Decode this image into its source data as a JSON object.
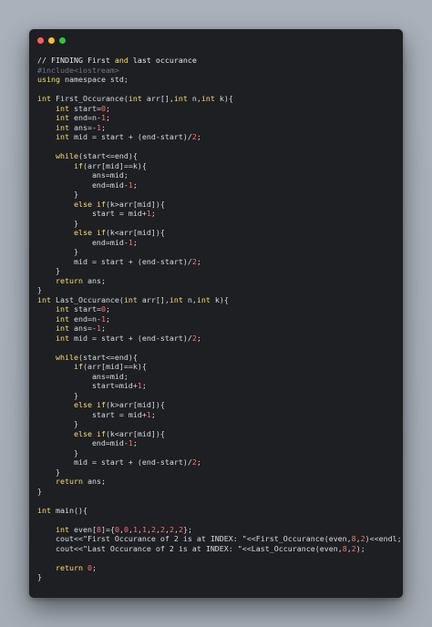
{
  "window": {
    "controls": [
      "close",
      "minimize",
      "maximize"
    ]
  },
  "code_lines": [
    [
      [
        "com",
        "// FINDING First "
      ],
      [
        "kw",
        "and"
      ],
      [
        "com",
        " last occurance"
      ]
    ],
    [
      [
        "pp",
        "#include<iostream>"
      ]
    ],
    [
      [
        "kw",
        "using"
      ],
      [
        "plain",
        " namespace std;"
      ]
    ],
    [],
    [
      [
        "ty",
        "int"
      ],
      [
        "plain",
        " First_Occurance("
      ],
      [
        "ty",
        "int"
      ],
      [
        "plain",
        " arr[],"
      ],
      [
        "ty",
        "int"
      ],
      [
        "plain",
        " n,"
      ],
      [
        "ty",
        "int"
      ],
      [
        "plain",
        " k){"
      ]
    ],
    [
      [
        "plain",
        "    "
      ],
      [
        "ty",
        "int"
      ],
      [
        "plain",
        " start="
      ],
      [
        "num",
        "0"
      ],
      [
        "plain",
        ";"
      ]
    ],
    [
      [
        "plain",
        "    "
      ],
      [
        "ty",
        "int"
      ],
      [
        "plain",
        " end=n-"
      ],
      [
        "num",
        "1"
      ],
      [
        "plain",
        ";"
      ]
    ],
    [
      [
        "plain",
        "    "
      ],
      [
        "ty",
        "int"
      ],
      [
        "plain",
        " ans=-"
      ],
      [
        "num",
        "1"
      ],
      [
        "plain",
        ";"
      ]
    ],
    [
      [
        "plain",
        "    "
      ],
      [
        "ty",
        "int"
      ],
      [
        "plain",
        " mid = start + (end-start)/"
      ],
      [
        "num",
        "2"
      ],
      [
        "plain",
        ";"
      ]
    ],
    [],
    [
      [
        "plain",
        "    "
      ],
      [
        "kw",
        "while"
      ],
      [
        "plain",
        "(start<=end){"
      ]
    ],
    [
      [
        "plain",
        "        "
      ],
      [
        "kw",
        "if"
      ],
      [
        "plain",
        "(arr[mid]==k){"
      ]
    ],
    [
      [
        "plain",
        "            ans=mid;"
      ]
    ],
    [
      [
        "plain",
        "            end=mid-"
      ],
      [
        "num",
        "1"
      ],
      [
        "plain",
        ";"
      ]
    ],
    [
      [
        "plain",
        "        }"
      ]
    ],
    [
      [
        "plain",
        "        "
      ],
      [
        "kw",
        "else if"
      ],
      [
        "plain",
        "(k>arr[mid]){"
      ]
    ],
    [
      [
        "plain",
        "            start = mid+"
      ],
      [
        "num",
        "1"
      ],
      [
        "plain",
        ";"
      ]
    ],
    [
      [
        "plain",
        "        }"
      ]
    ],
    [
      [
        "plain",
        "        "
      ],
      [
        "kw",
        "else if"
      ],
      [
        "plain",
        "(k<arr[mid]){"
      ]
    ],
    [
      [
        "plain",
        "            end=mid-"
      ],
      [
        "num",
        "1"
      ],
      [
        "plain",
        ";"
      ]
    ],
    [
      [
        "plain",
        "        }"
      ]
    ],
    [
      [
        "plain",
        "        mid = start + (end-start)/"
      ],
      [
        "num",
        "2"
      ],
      [
        "plain",
        ";"
      ]
    ],
    [
      [
        "plain",
        "    }"
      ]
    ],
    [
      [
        "plain",
        "    "
      ],
      [
        "kw",
        "return"
      ],
      [
        "plain",
        " ans;"
      ]
    ],
    [
      [
        "plain",
        "}"
      ]
    ],
    [
      [
        "ty",
        "int"
      ],
      [
        "plain",
        " Last_Occurance("
      ],
      [
        "ty",
        "int"
      ],
      [
        "plain",
        " arr[],"
      ],
      [
        "ty",
        "int"
      ],
      [
        "plain",
        " n,"
      ],
      [
        "ty",
        "int"
      ],
      [
        "plain",
        " k){"
      ]
    ],
    [
      [
        "plain",
        "    "
      ],
      [
        "ty",
        "int"
      ],
      [
        "plain",
        " start="
      ],
      [
        "num",
        "0"
      ],
      [
        "plain",
        ";"
      ]
    ],
    [
      [
        "plain",
        "    "
      ],
      [
        "ty",
        "int"
      ],
      [
        "plain",
        " end=n-"
      ],
      [
        "num",
        "1"
      ],
      [
        "plain",
        ";"
      ]
    ],
    [
      [
        "plain",
        "    "
      ],
      [
        "ty",
        "int"
      ],
      [
        "plain",
        " ans=-"
      ],
      [
        "num",
        "1"
      ],
      [
        "plain",
        ";"
      ]
    ],
    [
      [
        "plain",
        "    "
      ],
      [
        "ty",
        "int"
      ],
      [
        "plain",
        " mid = start + (end-start)/"
      ],
      [
        "num",
        "2"
      ],
      [
        "plain",
        ";"
      ]
    ],
    [],
    [
      [
        "plain",
        "    "
      ],
      [
        "kw",
        "while"
      ],
      [
        "plain",
        "(start<=end){"
      ]
    ],
    [
      [
        "plain",
        "        "
      ],
      [
        "kw",
        "if"
      ],
      [
        "plain",
        "(arr[mid]==k){"
      ]
    ],
    [
      [
        "plain",
        "            ans=mid;"
      ]
    ],
    [
      [
        "plain",
        "            start=mid+"
      ],
      [
        "num",
        "1"
      ],
      [
        "plain",
        ";"
      ]
    ],
    [
      [
        "plain",
        "        }"
      ]
    ],
    [
      [
        "plain",
        "        "
      ],
      [
        "kw",
        "else if"
      ],
      [
        "plain",
        "(k>arr[mid]){"
      ]
    ],
    [
      [
        "plain",
        "            start = mid+"
      ],
      [
        "num",
        "1"
      ],
      [
        "plain",
        ";"
      ]
    ],
    [
      [
        "plain",
        "        }"
      ]
    ],
    [
      [
        "plain",
        "        "
      ],
      [
        "kw",
        "else if"
      ],
      [
        "plain",
        "(k<arr[mid]){"
      ]
    ],
    [
      [
        "plain",
        "            end=mid-"
      ],
      [
        "num",
        "1"
      ],
      [
        "plain",
        ";"
      ]
    ],
    [
      [
        "plain",
        "        }"
      ]
    ],
    [
      [
        "plain",
        "        mid = start + (end-start)/"
      ],
      [
        "num",
        "2"
      ],
      [
        "plain",
        ";"
      ]
    ],
    [
      [
        "plain",
        "    }"
      ]
    ],
    [
      [
        "plain",
        "    "
      ],
      [
        "kw",
        "return"
      ],
      [
        "plain",
        " ans;"
      ]
    ],
    [
      [
        "plain",
        "}"
      ]
    ],
    [],
    [
      [
        "ty",
        "int"
      ],
      [
        "plain",
        " main(){"
      ]
    ],
    [],
    [
      [
        "plain",
        "    "
      ],
      [
        "ty",
        "int"
      ],
      [
        "plain",
        " even["
      ],
      [
        "num",
        "8"
      ],
      [
        "plain",
        "]={"
      ],
      [
        "num",
        "0"
      ],
      [
        "plain",
        ","
      ],
      [
        "num",
        "0"
      ],
      [
        "plain",
        ","
      ],
      [
        "num",
        "1"
      ],
      [
        "plain",
        ","
      ],
      [
        "num",
        "1"
      ],
      [
        "plain",
        ","
      ],
      [
        "num",
        "2"
      ],
      [
        "plain",
        ","
      ],
      [
        "num",
        "2"
      ],
      [
        "plain",
        ","
      ],
      [
        "num",
        "2"
      ],
      [
        "plain",
        ","
      ],
      [
        "num",
        "2"
      ],
      [
        "plain",
        "};"
      ]
    ],
    [
      [
        "plain",
        "    cout<<"
      ],
      [
        "str",
        "\"First Occurance of 2 is at INDEX: \""
      ],
      [
        "plain",
        "<<First_Occurance(even,"
      ],
      [
        "num",
        "8"
      ],
      [
        "plain",
        ","
      ],
      [
        "num",
        "2"
      ],
      [
        "plain",
        ")<<endl;;"
      ]
    ],
    [
      [
        "plain",
        "    cout<<"
      ],
      [
        "str",
        "\"Last Occurance of 2 is at INDEX: \""
      ],
      [
        "plain",
        "<<Last_Occurance(even,"
      ],
      [
        "num",
        "8"
      ],
      [
        "plain",
        ","
      ],
      [
        "num",
        "2"
      ],
      [
        "plain",
        ");"
      ]
    ],
    [],
    [
      [
        "plain",
        "    "
      ],
      [
        "kw",
        "return"
      ],
      [
        "plain",
        " "
      ],
      [
        "num",
        "0"
      ],
      [
        "plain",
        ";"
      ]
    ],
    [
      [
        "plain",
        "}"
      ]
    ]
  ],
  "colors": {
    "background": "#a9b0ba",
    "window": "#1e1f23",
    "keyword": "#f7df6d",
    "number": "#ff6e6e",
    "text": "#d7dae0",
    "preprocessor": "#6e7480",
    "close": "#ff5f57",
    "minimize": "#febc2e",
    "maximize": "#28c840"
  }
}
